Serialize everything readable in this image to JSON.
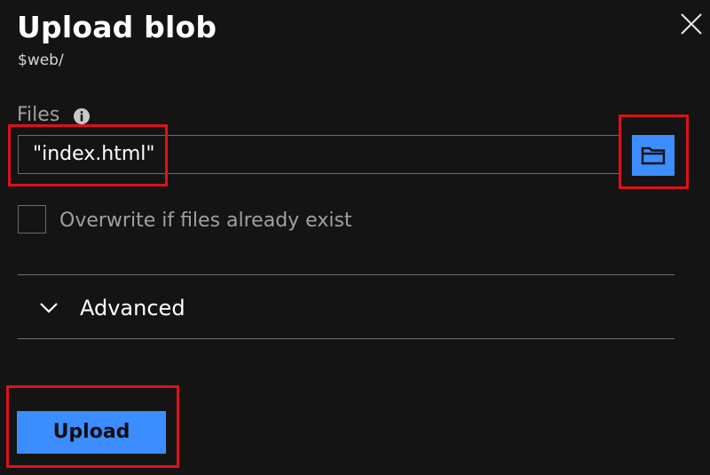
{
  "panel": {
    "title": "Upload blob",
    "subtitle": "$web/",
    "close_icon": "close-icon"
  },
  "files": {
    "label": "Files",
    "info_icon": "info-icon",
    "value": "\"index.html\"",
    "browse_icon": "folder-icon"
  },
  "overwrite": {
    "label": "Overwrite if files already exist",
    "checked": false
  },
  "advanced": {
    "label": "Advanced",
    "icon": "chevron-down-icon",
    "expanded": false
  },
  "actions": {
    "upload_label": "Upload"
  },
  "colors": {
    "background": "#141414",
    "accent": "#3c8dff",
    "highlight": "#e0101b"
  }
}
